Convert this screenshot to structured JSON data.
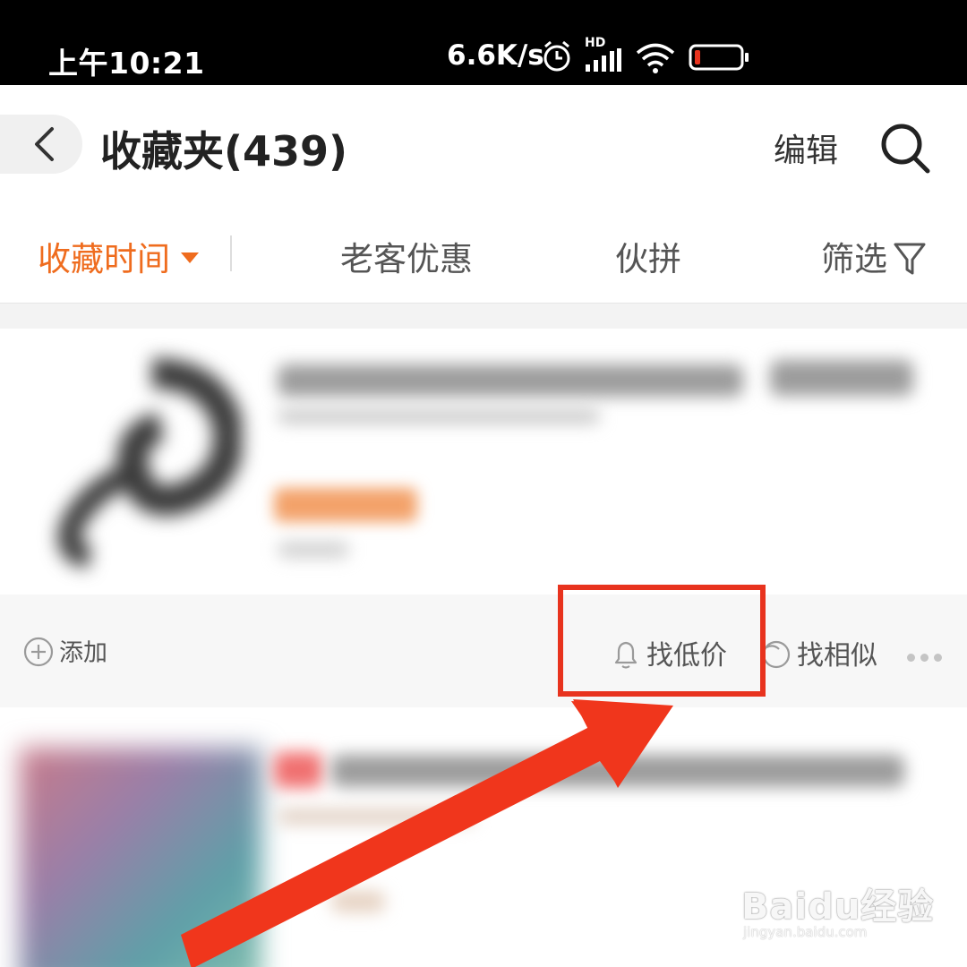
{
  "status_bar": {
    "time": "上午10:21",
    "net_speed": "6.6K/s",
    "signal_badge": "HD",
    "icons": [
      "alarm-icon",
      "signal-icon",
      "wifi-icon",
      "battery-icon"
    ],
    "battery_color": "#e8331e"
  },
  "header": {
    "title": "收藏夹(439)",
    "edit_label": "编辑",
    "icons": [
      "back-icon",
      "search-icon"
    ]
  },
  "tabs": [
    {
      "label": "收藏时间",
      "active": true
    },
    {
      "label": "老客优惠",
      "active": false
    },
    {
      "label": "伙拼",
      "active": false
    },
    {
      "label": "筛选",
      "active": false
    }
  ],
  "item_actions": {
    "add_label": "添加",
    "low_price_label": "找低价",
    "similar_label": "找相似",
    "icons": [
      "plus-circle-icon",
      "bell-icon",
      "similar-icon",
      "more-icon"
    ]
  },
  "colors": {
    "accent": "#ef6c1e",
    "annotation": "#e8331e"
  },
  "watermark": {
    "logo": "Baidu经验",
    "url": "jingyan.baidu.com"
  }
}
